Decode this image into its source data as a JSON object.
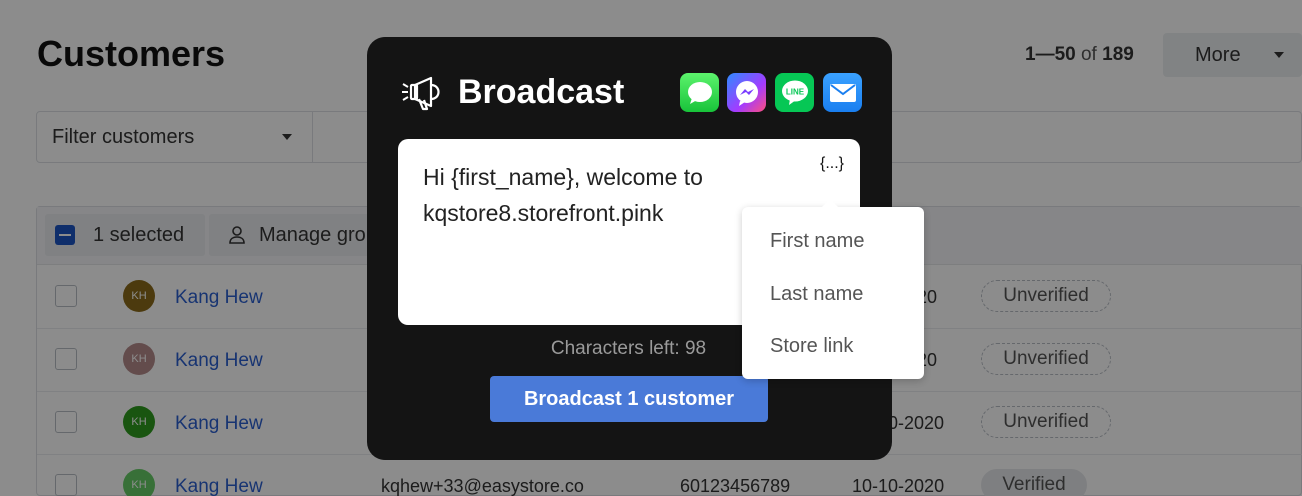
{
  "page": {
    "title": "Customers",
    "pager": {
      "range": "1—50",
      "of": "of",
      "total": "189"
    },
    "more_label": "More",
    "filter_placeholder": "Filter customers"
  },
  "table": {
    "selected_label": "1 selected",
    "manage_label": "Manage gro",
    "rows": [
      {
        "initials": "KH",
        "name": "Kang Hew",
        "email": "",
        "phone": "",
        "date": "20",
        "status": "Unverified",
        "avatar_color": "#8a6a1a"
      },
      {
        "initials": "KH",
        "name": "Kang Hew",
        "email": "",
        "phone": "",
        "date": "20",
        "status": "Unverified",
        "avatar_color": "#b48a8a"
      },
      {
        "initials": "KH",
        "name": "Kang Hew",
        "email": "",
        "phone": "",
        "date": "-10-2020",
        "status": "Unverified",
        "avatar_color": "#2e9b1e"
      },
      {
        "initials": "KH",
        "name": "Kang Hew",
        "email": "kqhew+33@easystore.co",
        "phone": "60123456789",
        "date": "10-10-2020",
        "status": "Verified",
        "avatar_color": "#66cc66"
      }
    ]
  },
  "modal": {
    "title": "Broadcast",
    "channels": [
      "messages-icon",
      "messenger-icon",
      "line-icon",
      "mail-icon"
    ],
    "message_line1": "Hi {first_name}, welcome to",
    "message_line2": "kqstore8.storefront.pink",
    "variable_button": "{...}",
    "characters_left": "Characters left: 98",
    "send_button": "Broadcast 1 customer"
  },
  "variables_menu": {
    "items": [
      "First name",
      "Last name",
      "Store link"
    ]
  },
  "colors": {
    "modal_bg": "#141414",
    "primary": "#4a7ad8",
    "link": "#2b5fd0"
  }
}
